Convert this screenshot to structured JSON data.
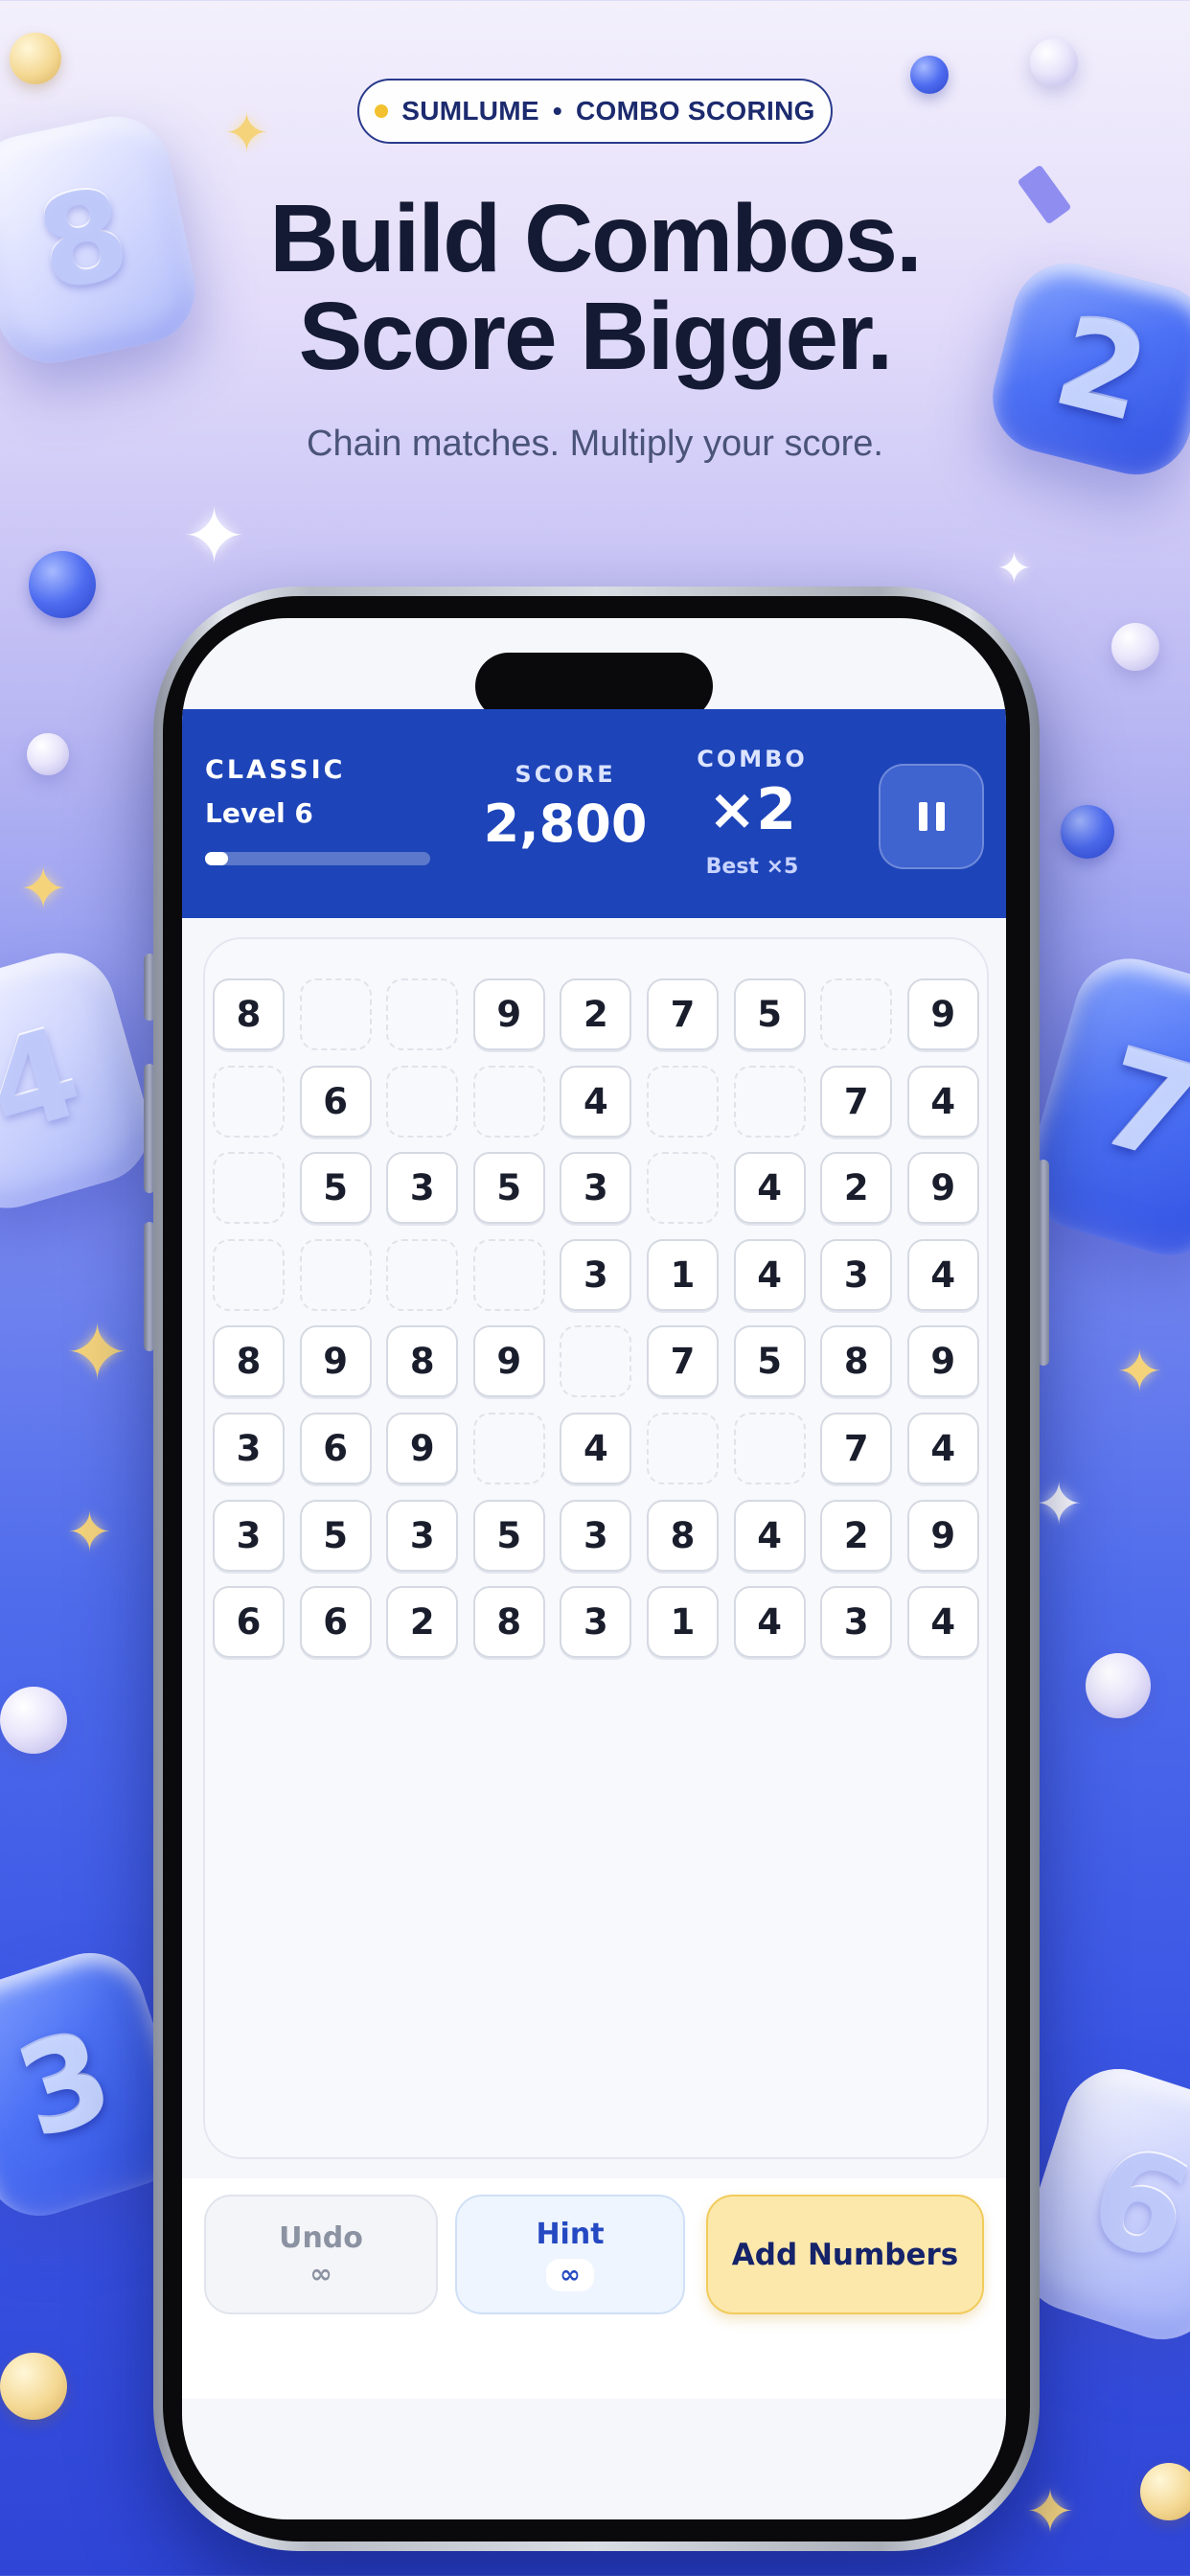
{
  "header": {
    "brand": "SUMLUME",
    "separator": "•",
    "tag": "COMBO SCORING",
    "headline_line1": "Build Combos.",
    "headline_line2": "Score Bigger.",
    "subheadline": "Chain matches. Multiply your score."
  },
  "game": {
    "mode": "CLASSIC",
    "level": "Level 6",
    "level_progress": 0.1,
    "score_label": "SCORE",
    "score": "2,800",
    "combo_label": "COMBO",
    "combo": "×2",
    "combo_best": "Best ×5",
    "pause_icon": "pause-icon"
  },
  "board": {
    "columns": 9,
    "rows": [
      [
        "8",
        "",
        "",
        "9",
        "2",
        "7",
        "5",
        "",
        "9"
      ],
      [
        "",
        "6",
        "",
        "",
        "4",
        "",
        "",
        "7",
        "4"
      ],
      [
        "",
        "5",
        "3",
        "5",
        "3",
        "",
        "4",
        "2",
        "9"
      ],
      [
        "",
        "",
        "",
        "",
        "3",
        "1",
        "4",
        "3",
        "4"
      ],
      [
        "8",
        "9",
        "8",
        "9",
        "",
        "7",
        "5",
        "8",
        "9"
      ],
      [
        "3",
        "6",
        "9",
        "",
        "4",
        "",
        "",
        "7",
        "4"
      ],
      [
        "3",
        "5",
        "3",
        "5",
        "3",
        "8",
        "4",
        "2",
        "9"
      ],
      [
        "6",
        "6",
        "2",
        "8",
        "3",
        "1",
        "4",
        "3",
        "4"
      ]
    ]
  },
  "actions": {
    "undo_label": "Undo",
    "undo_count": "∞",
    "hint_label": "Hint",
    "hint_count": "∞",
    "add_label": "Add Numbers"
  },
  "decor": {
    "cube_numbers": [
      "8",
      "2",
      "4",
      "7",
      "3",
      "6"
    ],
    "colors": {
      "accent_blue": "#1d44b8",
      "headline": "#141a33",
      "add_button": "#fde8ab",
      "pill_dot": "#f3c12f"
    }
  }
}
